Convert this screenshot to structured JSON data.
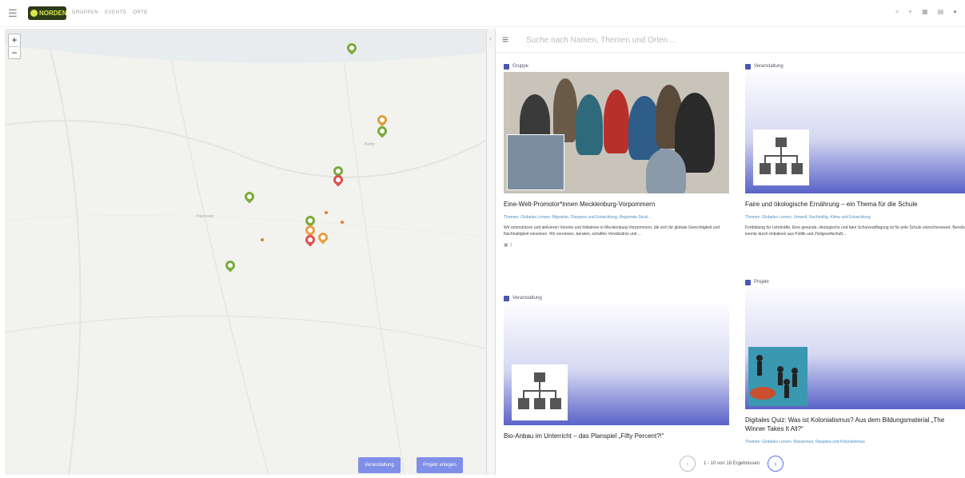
{
  "topbar": {
    "logo_text": "NORDEN",
    "nav": [
      "GRUPPEN",
      "EVENTS",
      "ORTE"
    ],
    "right_icons": [
      "search-icon",
      "plus-icon",
      "grid-icon",
      "list-icon",
      "user-icon"
    ]
  },
  "map": {
    "zoom_in": "+",
    "zoom_out": "−",
    "labels": [
      "Berlin",
      "Hannover"
    ],
    "btn_event": "Veranstaltung",
    "btn_project": "Projekt anlegen"
  },
  "panel": {
    "search_placeholder": "Suche nach Namen, Themen und Orten ...",
    "cards": [
      {
        "type": "Gruppe",
        "title": "Eine-Welt-Promotor*innen Mecklenburg-Vorpommern",
        "tags": "Themen: Globales Lernen, Migration, Diaspora und Entwicklung, Regionale Struk...",
        "desc": "Wir unterstützen und aktivieren Vereine und Initiativen in Mecklenburg-Vorpommern, die sich für globale Gerechtigkeit und Nachhaltigkeit einsetzen. Wir vernetzen, beraten, schaffen Verständnis und ...",
        "foot": "1"
      },
      {
        "type": "Veranstaltung",
        "title": "Faire und ökologische Ernährung – ein Thema für die Schule",
        "tags": "Themen: Globales Lernen, Umwelt, Nachhaltig, Klima und Entwicklung",
        "desc": "Fortbildung für Lehrkräfte. Eine gesunde, ökologische und faire Schulverpflegung ist für jede Schule wünschenswert. Bereits konnte durch Initiativen aus Politik und Zivilgesellschaft...",
        "foot": ""
      },
      {
        "type": "Veranstaltung",
        "title": "Bio-Anbau im Unterricht – das Planspiel „Fifty Percent?!“",
        "tags": "",
        "desc": "",
        "foot": ""
      },
      {
        "type": "Projekt",
        "title": "Digitales Quiz: Was ist Kolonialismus? Aus dem Bildungsmaterial „The Winner Takes It All?“",
        "tags": "Themen: Globales Lernen, Rassismus, Diaspora und Kolonialismus",
        "desc": "",
        "foot": ""
      }
    ],
    "pager": {
      "text": "1 - 10 von 18 Ergebnissen",
      "prev": "‹",
      "next": "›"
    }
  },
  "colors": {
    "accent": "#5a6de0",
    "pin_green": "#7aaa3a",
    "pin_red": "#d9534f",
    "pin_orange": "#e8a040"
  }
}
